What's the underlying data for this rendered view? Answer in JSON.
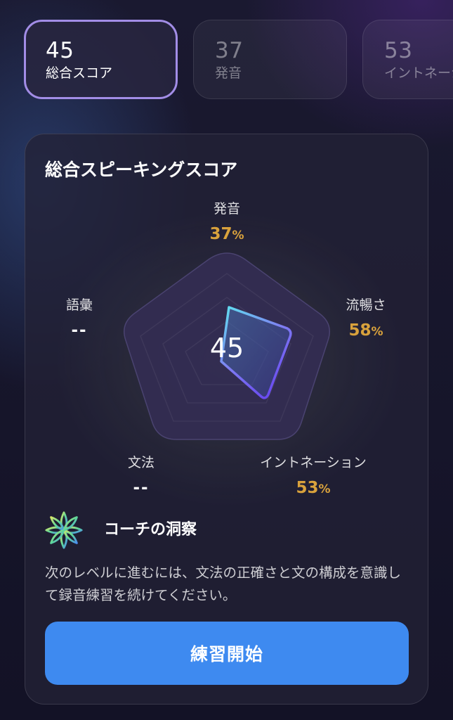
{
  "tabs": [
    {
      "score": "45",
      "label": "総合スコア",
      "active": true
    },
    {
      "score": "37",
      "label": "発音",
      "active": false
    },
    {
      "score": "53",
      "label": "イントネーション",
      "active": false
    }
  ],
  "card": {
    "title": "総合スピーキングスコア",
    "center_score": "45",
    "metrics": {
      "pronunciation": {
        "name": "発音",
        "value": "37",
        "unit": "%"
      },
      "fluency": {
        "name": "流暢さ",
        "value": "58",
        "unit": "%"
      },
      "intonation": {
        "name": "イントネーション",
        "value": "53",
        "unit": "%"
      },
      "grammar": {
        "name": "文法",
        "value": "--"
      },
      "vocabulary": {
        "name": "語彙",
        "value": "--"
      }
    }
  },
  "coach": {
    "title": "コーチの洞察",
    "text": "次のレベルに進むには、文法の正確さと文の構成を意識して録音練習を続けてください。"
  },
  "start_button": {
    "label": "練習開始"
  },
  "colors": {
    "accent_border": "#a28de6",
    "score_value": "#d9a23c",
    "button": "#3e8af0",
    "radar_line_start": "#5fe3f0",
    "radar_line_end": "#6a4cf0"
  }
}
